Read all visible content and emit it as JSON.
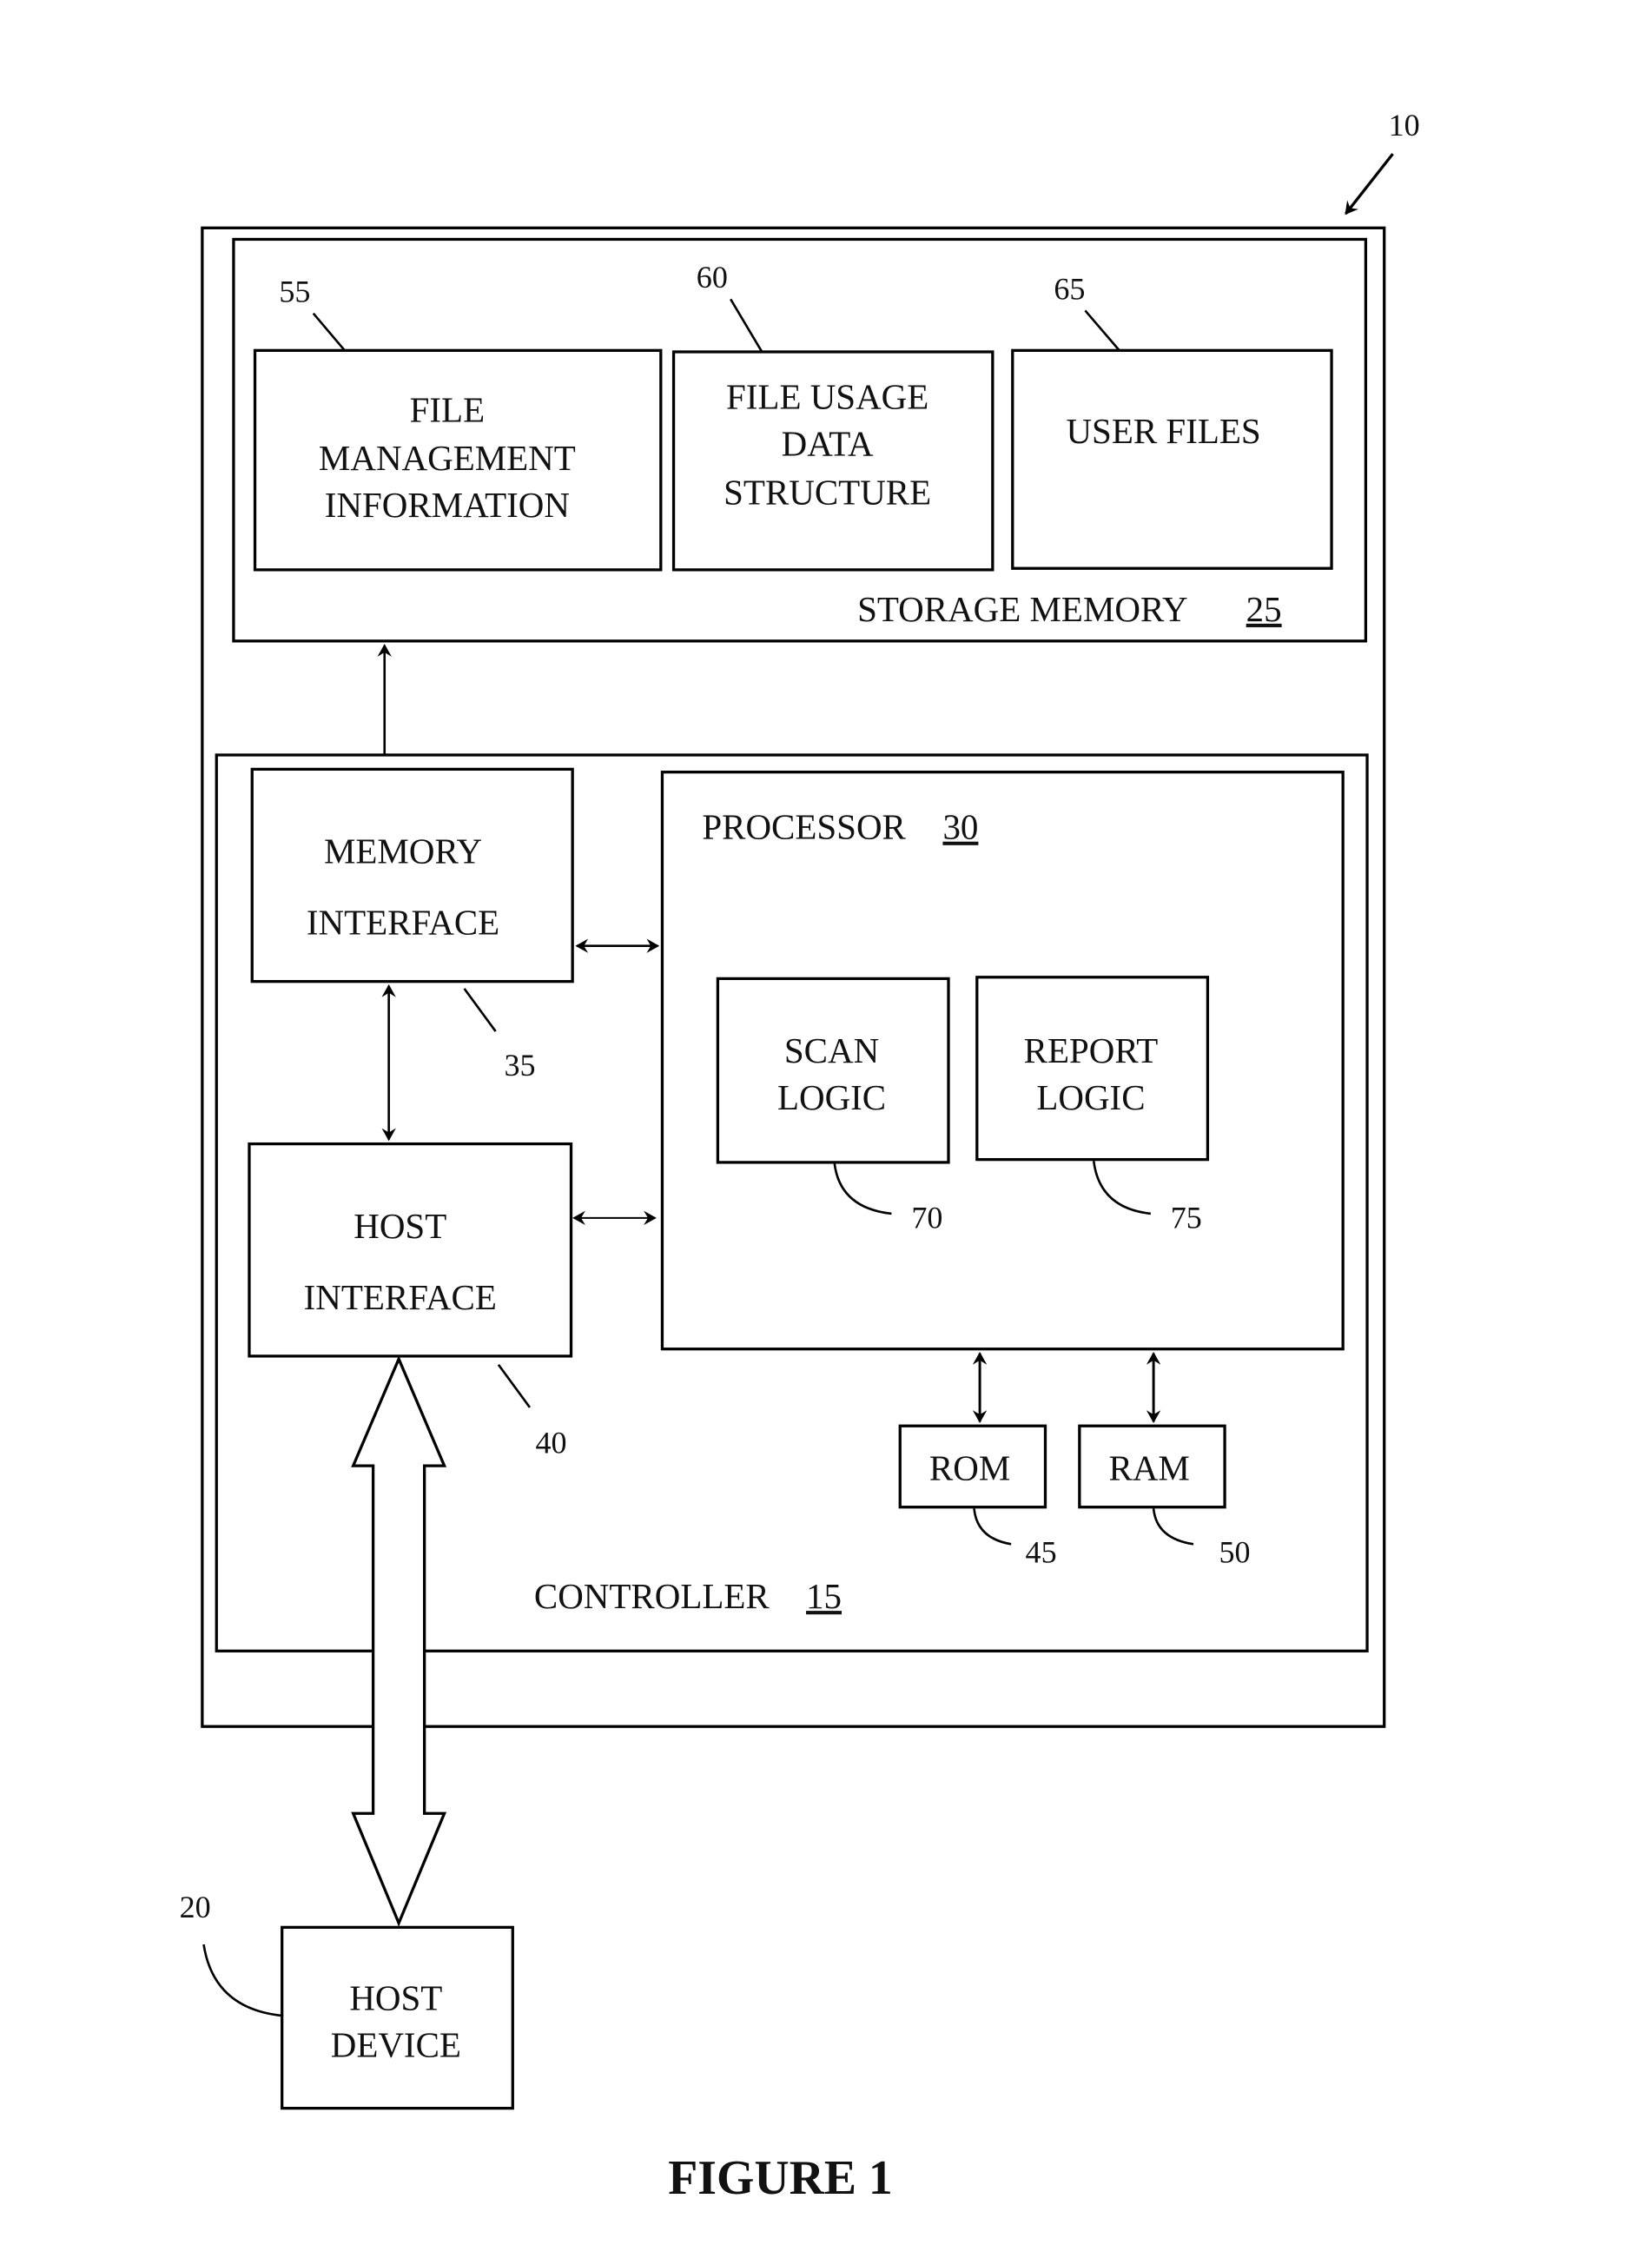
{
  "figure": {
    "caption": "FIGURE 1",
    "system_ref": "10",
    "storage_memory": {
      "label": "STORAGE MEMORY",
      "ref": "25",
      "blocks": [
        {
          "lines": [
            "FILE",
            "MANAGEMENT",
            "INFORMATION"
          ],
          "ref": "55"
        },
        {
          "lines": [
            "FILE USAGE",
            "DATA",
            "STRUCTURE"
          ],
          "ref": "60"
        },
        {
          "lines": [
            "USER FILES"
          ],
          "ref": "65"
        }
      ]
    },
    "controller": {
      "label": "CONTROLLER",
      "ref": "15",
      "memory_interface": {
        "lines": [
          "MEMORY",
          "INTERFACE"
        ],
        "ref": "35"
      },
      "host_interface": {
        "lines": [
          "HOST",
          "INTERFACE"
        ],
        "ref": "40"
      },
      "processor": {
        "label": "PROCESSOR",
        "ref": "30",
        "scan_logic": {
          "lines": [
            "SCAN",
            "LOGIC"
          ],
          "ref": "70"
        },
        "report_logic": {
          "lines": [
            "REPORT",
            "LOGIC"
          ],
          "ref": "75"
        }
      },
      "rom": {
        "label": "ROM",
        "ref": "45"
      },
      "ram": {
        "label": "RAM",
        "ref": "50"
      }
    },
    "host_device": {
      "lines": [
        "HOST",
        "DEVICE"
      ],
      "ref": "20"
    }
  }
}
